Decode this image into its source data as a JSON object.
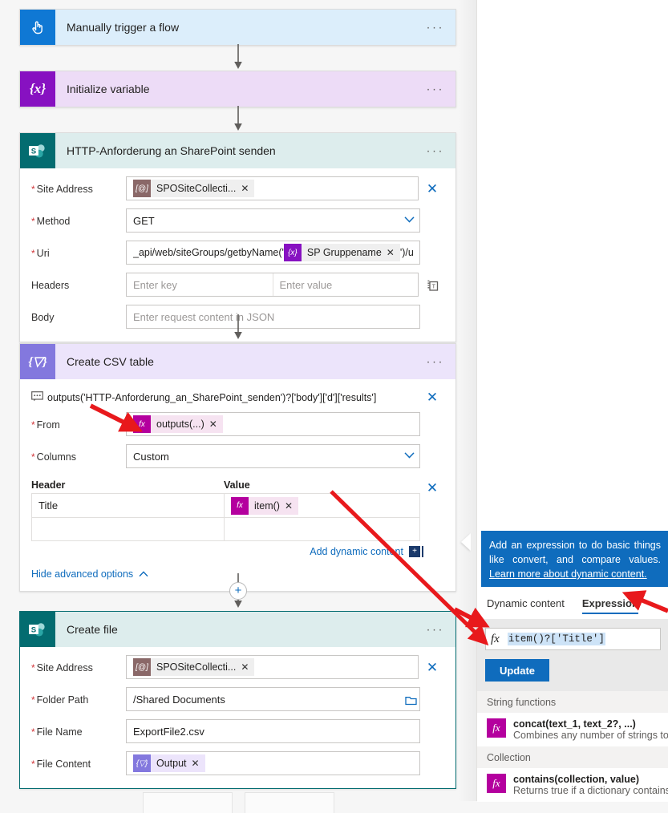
{
  "flow": {
    "steps": [
      {
        "id": "manual-trigger",
        "title": "Manually trigger a flow",
        "icon": "hand-tap-icon",
        "icon_glyph": "☝",
        "header_color": "#dceefb",
        "icon_color": "#0f78d4"
      },
      {
        "id": "initialize-variable",
        "title": "Initialize variable",
        "icon": "variable-braces-icon",
        "icon_glyph": "{x}",
        "header_color": "#eddcf7",
        "icon_color": "#8711c1"
      },
      {
        "id": "send-http-request-sharepoint",
        "title": "HTTP-Anforderung an SharePoint senden",
        "icon": "sharepoint-icon",
        "icon_glyph": "S",
        "header_color": "#ddeded",
        "icon_color": "#036c70"
      },
      {
        "id": "create-csv-table",
        "title": "Create CSV table",
        "icon": "csv-table-icon",
        "icon_glyph": "{▽}",
        "header_color": "#ece4fb",
        "icon_color": "#8378de"
      },
      {
        "id": "create-file",
        "title": "Create file",
        "icon": "sharepoint-icon",
        "icon_glyph": "S",
        "header_color": "#ddeded",
        "icon_color": "#036c70"
      }
    ],
    "ellipsis": "···",
    "add_step_plus": "+"
  },
  "http_step": {
    "site_address": {
      "label": "Site Address",
      "token": "SPOSiteCollecti...",
      "token_icon": "[@]"
    },
    "method": {
      "label": "Method",
      "value": "GET"
    },
    "uri": {
      "label": "Uri",
      "prefix": "_api/web/siteGroups/getbyName('",
      "token": "SP Gruppename",
      "token_icon": "{x}",
      "suffix": "')/users"
    },
    "headers": {
      "label": "Headers",
      "key_placeholder": "Enter key",
      "value_placeholder": "Enter value",
      "mode_icon": "text-mode-icon"
    },
    "body": {
      "label": "Body",
      "placeholder": "Enter request content in JSON"
    }
  },
  "csv_step": {
    "comment": "outputs('HTTP-Anforderung_an_SharePoint_senden')?['body']['d']['results']",
    "comment_icon": "comment-bubble-icon",
    "from": {
      "label": "From",
      "token": "outputs(...)",
      "token_icon": "fx"
    },
    "columns": {
      "label": "Columns",
      "value": "Custom"
    },
    "table": {
      "headers": [
        "Header",
        "Value"
      ],
      "rows": [
        {
          "header": "Title",
          "value_token": "item()",
          "value_token_icon": "fx"
        },
        {
          "header": "",
          "value_token": "",
          "value_token_icon": ""
        }
      ]
    },
    "add_dynamic_content": "Add dynamic content",
    "advanced_toggle": "Hide advanced options"
  },
  "file_step": {
    "site_address": {
      "label": "Site Address",
      "token": "SPOSiteCollecti...",
      "token_icon": "[@]"
    },
    "folder_path": {
      "label": "Folder Path",
      "value": "/Shared Documents",
      "picker_icon": "folder-picker-icon"
    },
    "file_name": {
      "label": "File Name",
      "value": "ExportFile2.csv"
    },
    "file_content": {
      "label": "File Content",
      "token": "Output",
      "token_icon": "{▽}"
    }
  },
  "panel": {
    "callout": {
      "text_before_link": "Add an expression to do basic things like convert, and compare values. ",
      "link_text": "Learn more about dynamic content.",
      "background": "#0f6cbd"
    },
    "tabs": [
      {
        "label": "Dynamic content",
        "active": false
      },
      {
        "label": "Expression",
        "active": true
      }
    ],
    "expression": {
      "fx_icon": "fx",
      "value": "item()?['Title']",
      "update_button": "Update"
    },
    "function_groups": [
      {
        "title": "String functions",
        "items": [
          {
            "name": "concat(text_1, text_2?, ...)",
            "desc": "Combines any number of strings together",
            "icon": "fx"
          }
        ]
      },
      {
        "title": "Collection",
        "items": [
          {
            "name": "contains(collection, value)",
            "desc": "Returns true if a dictionary contains a key",
            "icon": "fx"
          }
        ]
      }
    ]
  },
  "annotations": {
    "accent_color": "#e8191c",
    "arrows": [
      "arrow-to-from-field",
      "arrow-to-expression-tab",
      "arrow-to-expression-input",
      "arrow-value-field-to-expression-input"
    ]
  }
}
